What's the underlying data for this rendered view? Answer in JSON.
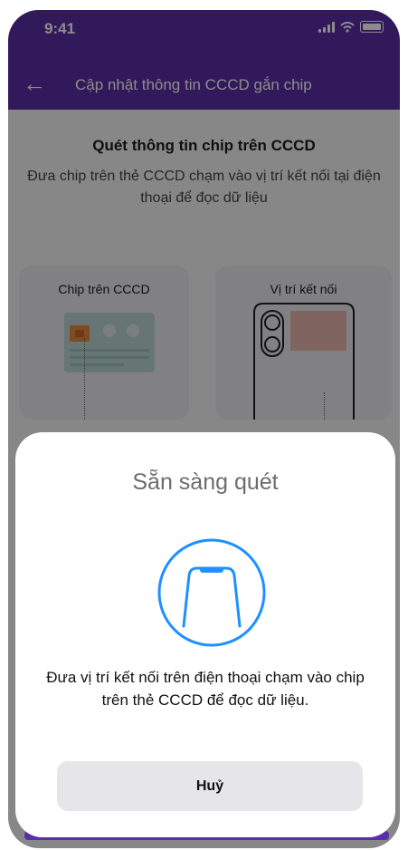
{
  "status_bar": {
    "time": "9:41"
  },
  "nav": {
    "title": "Cập nhật thông tin CCCD gắn chip"
  },
  "main": {
    "heading": "Quét thông tin chip trên CCCD",
    "description": "Đưa chip trên thẻ CCCD chạm vào vị trí kết nối tại điện thoại để đọc dữ liệu",
    "cards": [
      {
        "label": "Chip trên CCCD"
      },
      {
        "label": "Vị trí kết nối"
      }
    ]
  },
  "sheet": {
    "title": "Sẵn sàng quét",
    "message": "Đưa vị trí kết nối trên điện thoại chạm vào chip trên thẻ CCCD để đọc dữ liệu.",
    "cancel_label": "Huỷ"
  },
  "colors": {
    "header": "#5a2ea6",
    "accent": "#1e90ff"
  },
  "icons": [
    "back-arrow-icon",
    "signal-icon",
    "wifi-icon",
    "battery-icon",
    "id-card-chip-icon",
    "phone-back-camera-icon",
    "phone-scan-icon"
  ]
}
